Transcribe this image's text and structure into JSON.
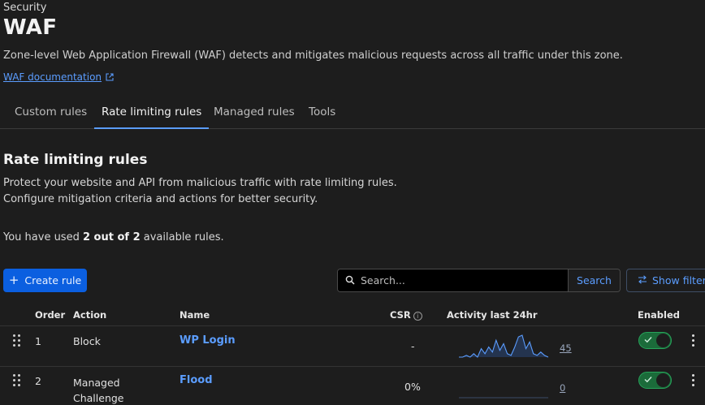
{
  "header": {
    "section": "Security",
    "title": "WAF",
    "description": "Zone-level Web Application Firewall (WAF) detects and mitigates malicious requests across all traffic under this zone.",
    "doc_link": "WAF documentation"
  },
  "tabs": [
    {
      "label": "Custom rules"
    },
    {
      "label": "Rate limiting rules"
    },
    {
      "label": "Managed rules"
    },
    {
      "label": "Tools"
    }
  ],
  "active_tab": "Rate limiting rules",
  "rate_limiting": {
    "title": "Rate limiting rules",
    "description": "Protect your website and API from malicious traffic with rate limiting rules. Configure mitigation criteria and actions for better security.",
    "usage_prefix": "You have used ",
    "usage_bold": "2 out of 2",
    "usage_suffix": " available rules."
  },
  "toolbar": {
    "create_label": "Create rule",
    "search_placeholder": "Search...",
    "search_button": "Search",
    "filters_label": "Show filters"
  },
  "table": {
    "columns": {
      "order": "Order",
      "action": "Action",
      "name": "Name",
      "csr": "CSR",
      "activity": "Activity last 24hr",
      "enabled": "Enabled"
    },
    "rows": [
      {
        "order": "1",
        "action": "Block",
        "name": "WP Login",
        "csr": "-",
        "count": "45",
        "enabled": true,
        "activity": [
          0,
          0,
          1,
          0,
          2,
          0,
          5,
          2,
          6,
          3,
          10,
          4,
          8,
          2,
          1,
          6,
          12,
          13,
          5,
          9,
          2,
          1,
          3,
          1,
          0
        ]
      },
      {
        "order": "2",
        "action_line1": "Managed",
        "action_line2": "Challenge",
        "name": "Flood",
        "csr": "0%",
        "count": "0",
        "enabled": true,
        "activity": [
          0,
          0,
          0,
          0,
          0,
          0,
          0,
          0,
          0,
          0,
          0,
          0,
          0,
          0,
          0,
          0,
          0,
          0,
          0,
          0,
          0,
          0,
          0,
          0,
          0
        ]
      }
    ]
  },
  "colors": {
    "accent": "#5b9dff",
    "primary_button": "#0b5fe0",
    "toggle_on": "#27a35a"
  }
}
